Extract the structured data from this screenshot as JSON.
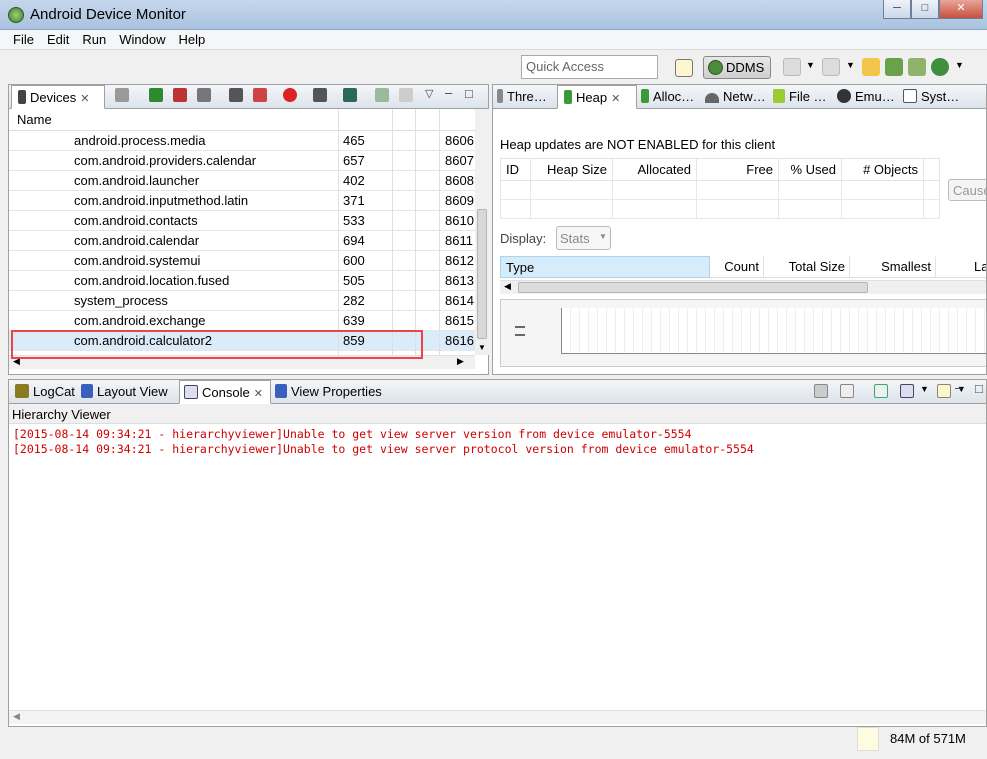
{
  "window": {
    "title": "Android Device Monitor",
    "min": "─",
    "max": "□",
    "close": "✕"
  },
  "menu": [
    "File",
    "Edit",
    "Run",
    "Window",
    "Help"
  ],
  "toolbar": {
    "quick_access_placeholder": "Quick Access",
    "perspective": "DDMS"
  },
  "devices_panel": {
    "tab_label": "Devices",
    "column_name": "Name",
    "rows": [
      {
        "name": "android.process.media",
        "pid": "465",
        "port": "8606"
      },
      {
        "name": "com.android.providers.calendar",
        "pid": "657",
        "port": "8607"
      },
      {
        "name": "com.android.launcher",
        "pid": "402",
        "port": "8608"
      },
      {
        "name": "com.android.inputmethod.latin",
        "pid": "371",
        "port": "8609"
      },
      {
        "name": "com.android.contacts",
        "pid": "533",
        "port": "8610"
      },
      {
        "name": "com.android.calendar",
        "pid": "694",
        "port": "8611"
      },
      {
        "name": "com.android.systemui",
        "pid": "600",
        "port": "8612"
      },
      {
        "name": "com.android.location.fused",
        "pid": "505",
        "port": "8613"
      },
      {
        "name": "system_process",
        "pid": "282",
        "port": "8614"
      },
      {
        "name": "com.android.exchange",
        "pid": "639",
        "port": "8615"
      },
      {
        "name": "com.android.calculator2",
        "pid": "859",
        "port": "8616"
      }
    ]
  },
  "right_panel": {
    "tabs": [
      "Thre…",
      "Heap",
      "Alloc…",
      "Netw…",
      "File …",
      "Emu…",
      "Syst…"
    ],
    "heap_message": "Heap updates are NOT ENABLED for this client",
    "heap_columns": [
      "ID",
      "Heap Size",
      "Allocated",
      "Free",
      "% Used",
      "# Objects"
    ],
    "cause_gc": "Cause",
    "display_label": "Display:",
    "display_value": "Stats",
    "type_columns": [
      "Type",
      "Count",
      "Total Size",
      "Smallest",
      "La"
    ]
  },
  "bottom_panel": {
    "tabs": [
      "LogCat",
      "Layout View",
      "Console",
      "View Properties"
    ],
    "console_title": "Hierarchy Viewer",
    "lines": [
      "[2015-08-14 09:34:21 - hierarchyviewer]Unable to get view server version from device emulator-5554",
      "[2015-08-14 09:34:21 - hierarchyviewer]Unable to get view server protocol version from device emulator-5554"
    ]
  },
  "status": {
    "memory": "84M of 571M"
  }
}
